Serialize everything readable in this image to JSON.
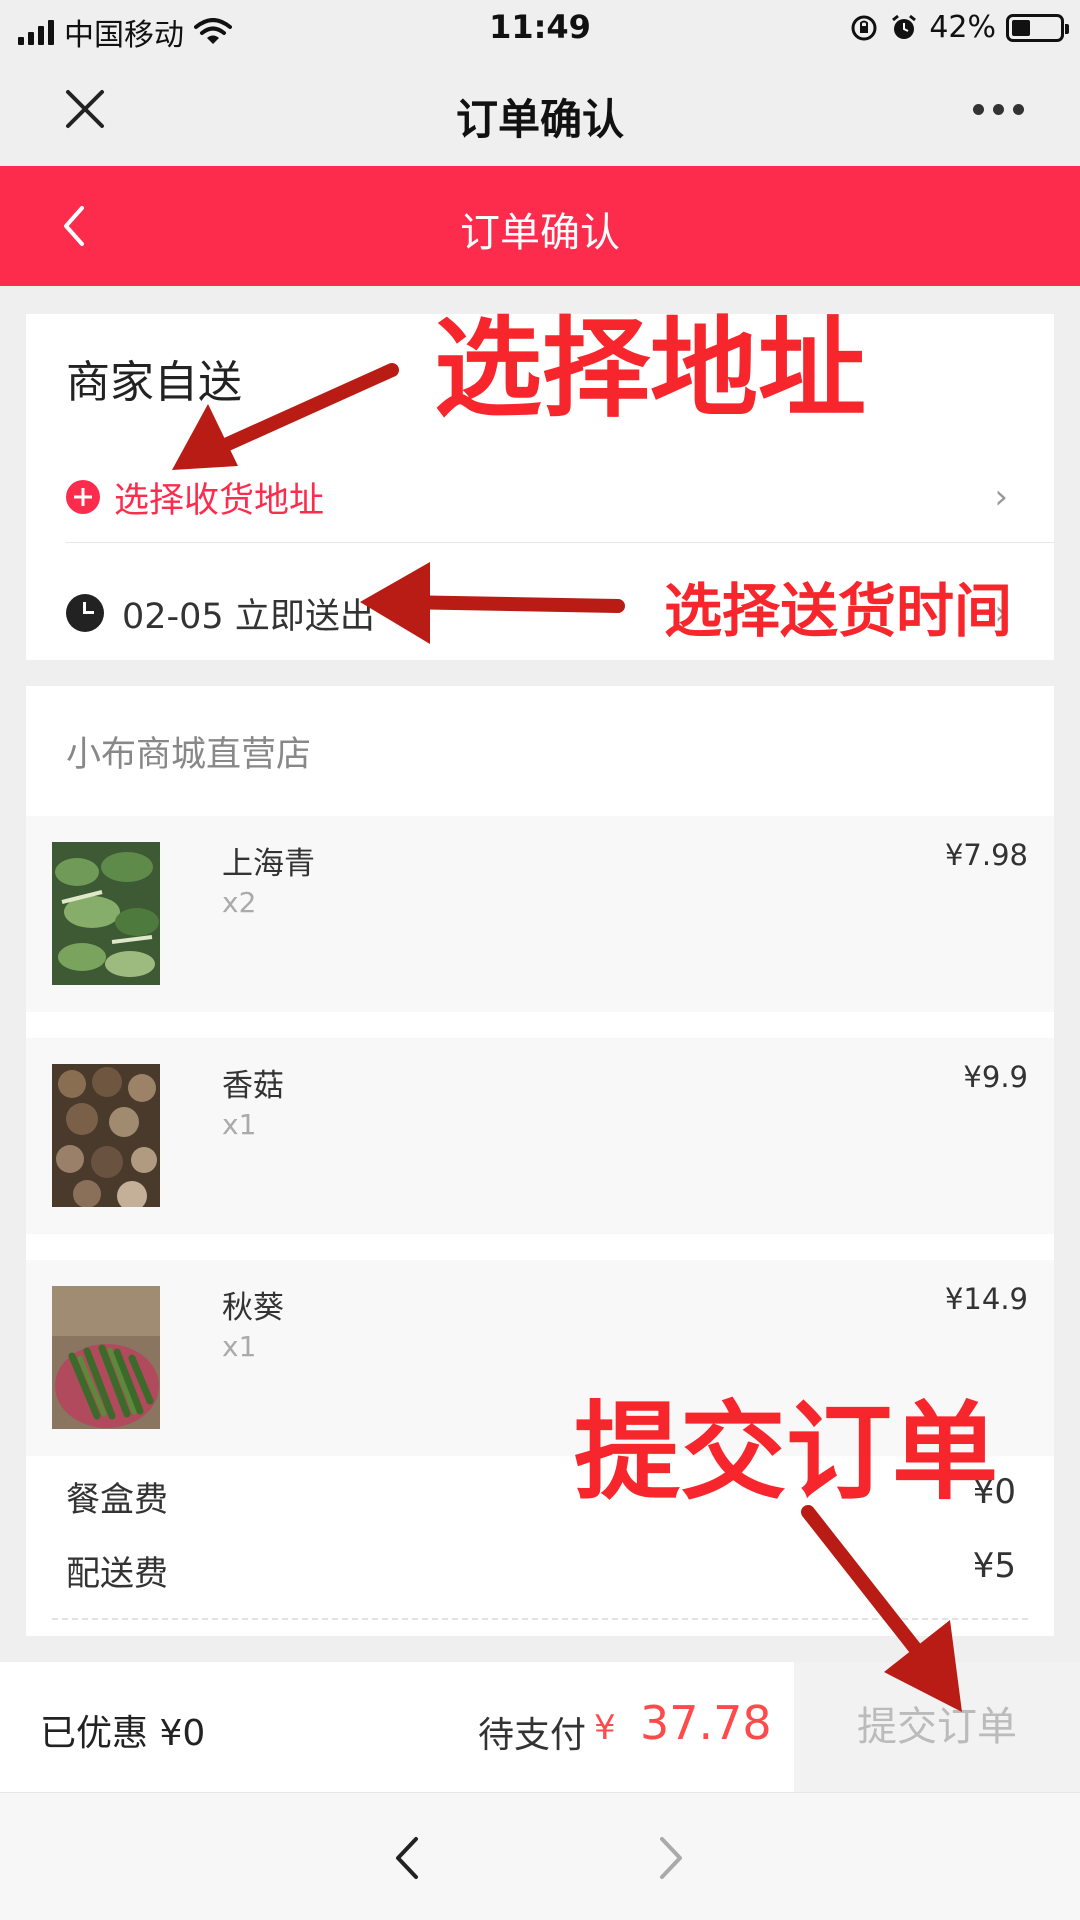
{
  "status_bar": {
    "carrier": "中国移动",
    "time": "11:49",
    "battery": "42%"
  },
  "wechat_bar": {
    "title": "订单确认"
  },
  "header": {
    "title": "订单确认"
  },
  "delivery": {
    "title": "商家自送",
    "address_placeholder": "选择收货地址",
    "time_text": "02-05 立即送出"
  },
  "store": {
    "name": "小布商城直营店",
    "items": [
      {
        "name": "上海青",
        "qty": "x2",
        "price": "¥7.98"
      },
      {
        "name": "香菇",
        "qty": "x1",
        "price": "¥9.9"
      },
      {
        "name": "秋葵",
        "qty": "x1",
        "price": "¥14.9"
      }
    ],
    "fees": [
      {
        "label": "餐盒费",
        "value": "¥0"
      },
      {
        "label": "配送费",
        "value": "¥5"
      }
    ]
  },
  "footer": {
    "discount_label": "已优惠 ¥0",
    "pay_label": "待支付",
    "pay_currency": "¥",
    "pay_amount": "37.78",
    "submit_label": "提交订单"
  },
  "annotations": {
    "select_address": "选择地址",
    "select_time": "选择送货时间",
    "submit_order": "提交订单"
  },
  "colors": {
    "accent": "#fe2c4c",
    "price": "#fe4a4a",
    "annotation": "#f7262c",
    "arrow": "#b81c14"
  }
}
